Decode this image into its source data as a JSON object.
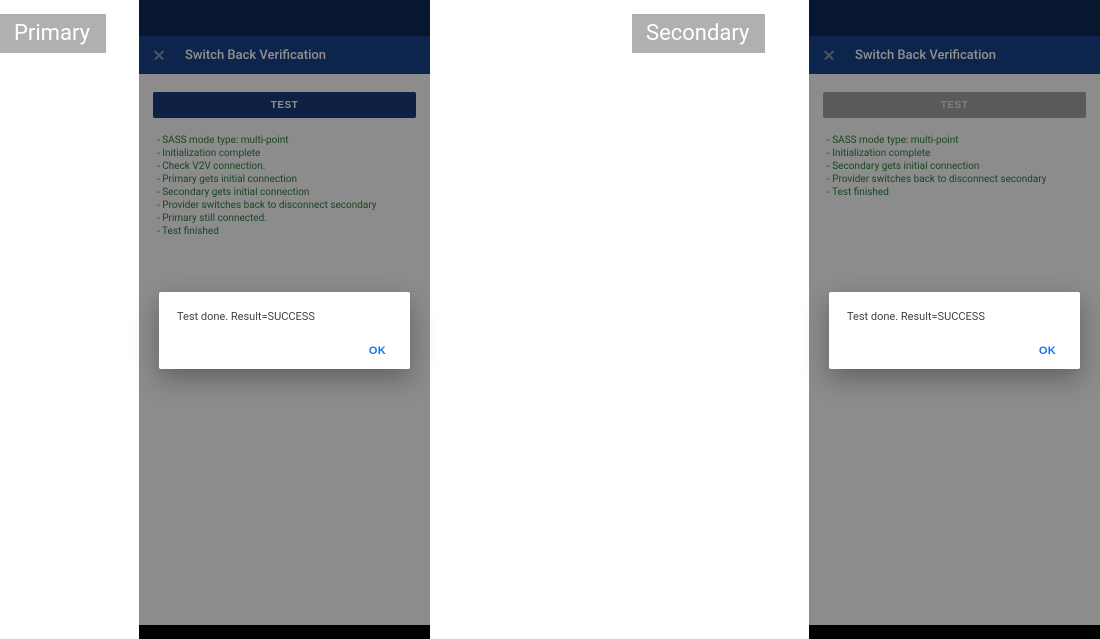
{
  "labels": {
    "primary": "Primary",
    "secondary": "Secondary"
  },
  "app_bar": {
    "title": "Switch Back Verification"
  },
  "buttons": {
    "test": "TEST",
    "ok": "OK"
  },
  "logs": {
    "primary": [
      "- SASS mode type: multi-point",
      "- Initialization complete",
      "- Check V2V connection.",
      "- Primary gets initial connection",
      "- Secondary gets initial connection",
      "- Provider switches back to disconnect secondary",
      "- Primary still connected.",
      "- Test finished"
    ],
    "secondary": [
      "- SASS mode type: multi-point",
      "- Initialization complete",
      "- Secondary gets initial connection",
      "- Provider switches back to disconnect secondary",
      "- Test finished"
    ]
  },
  "dialog": {
    "text": "Test done. Result=SUCCESS"
  }
}
